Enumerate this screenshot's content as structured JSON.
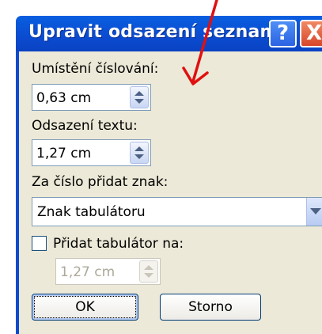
{
  "dialog": {
    "title": "Upravit odsazení seznamu",
    "help_glyph": "?",
    "close_glyph": "X"
  },
  "numbering_position": {
    "label": "Umístění číslování:",
    "value": "0,63 cm"
  },
  "text_indent": {
    "label": "Odsazení textu:",
    "value": "1,27 cm"
  },
  "follow_number": {
    "label": "Za číslo přidat znak:",
    "value": "Znak tabulátoru"
  },
  "add_tab": {
    "label": "Přidat tabulátor na:",
    "checked": false,
    "value": "1,27 cm"
  },
  "buttons": {
    "ok": "OK",
    "cancel": "Storno"
  },
  "colors": {
    "annotation_arrow": "#e01010",
    "title_bar": "#0b4bd0",
    "dialog_bg": "#ece9d8"
  }
}
